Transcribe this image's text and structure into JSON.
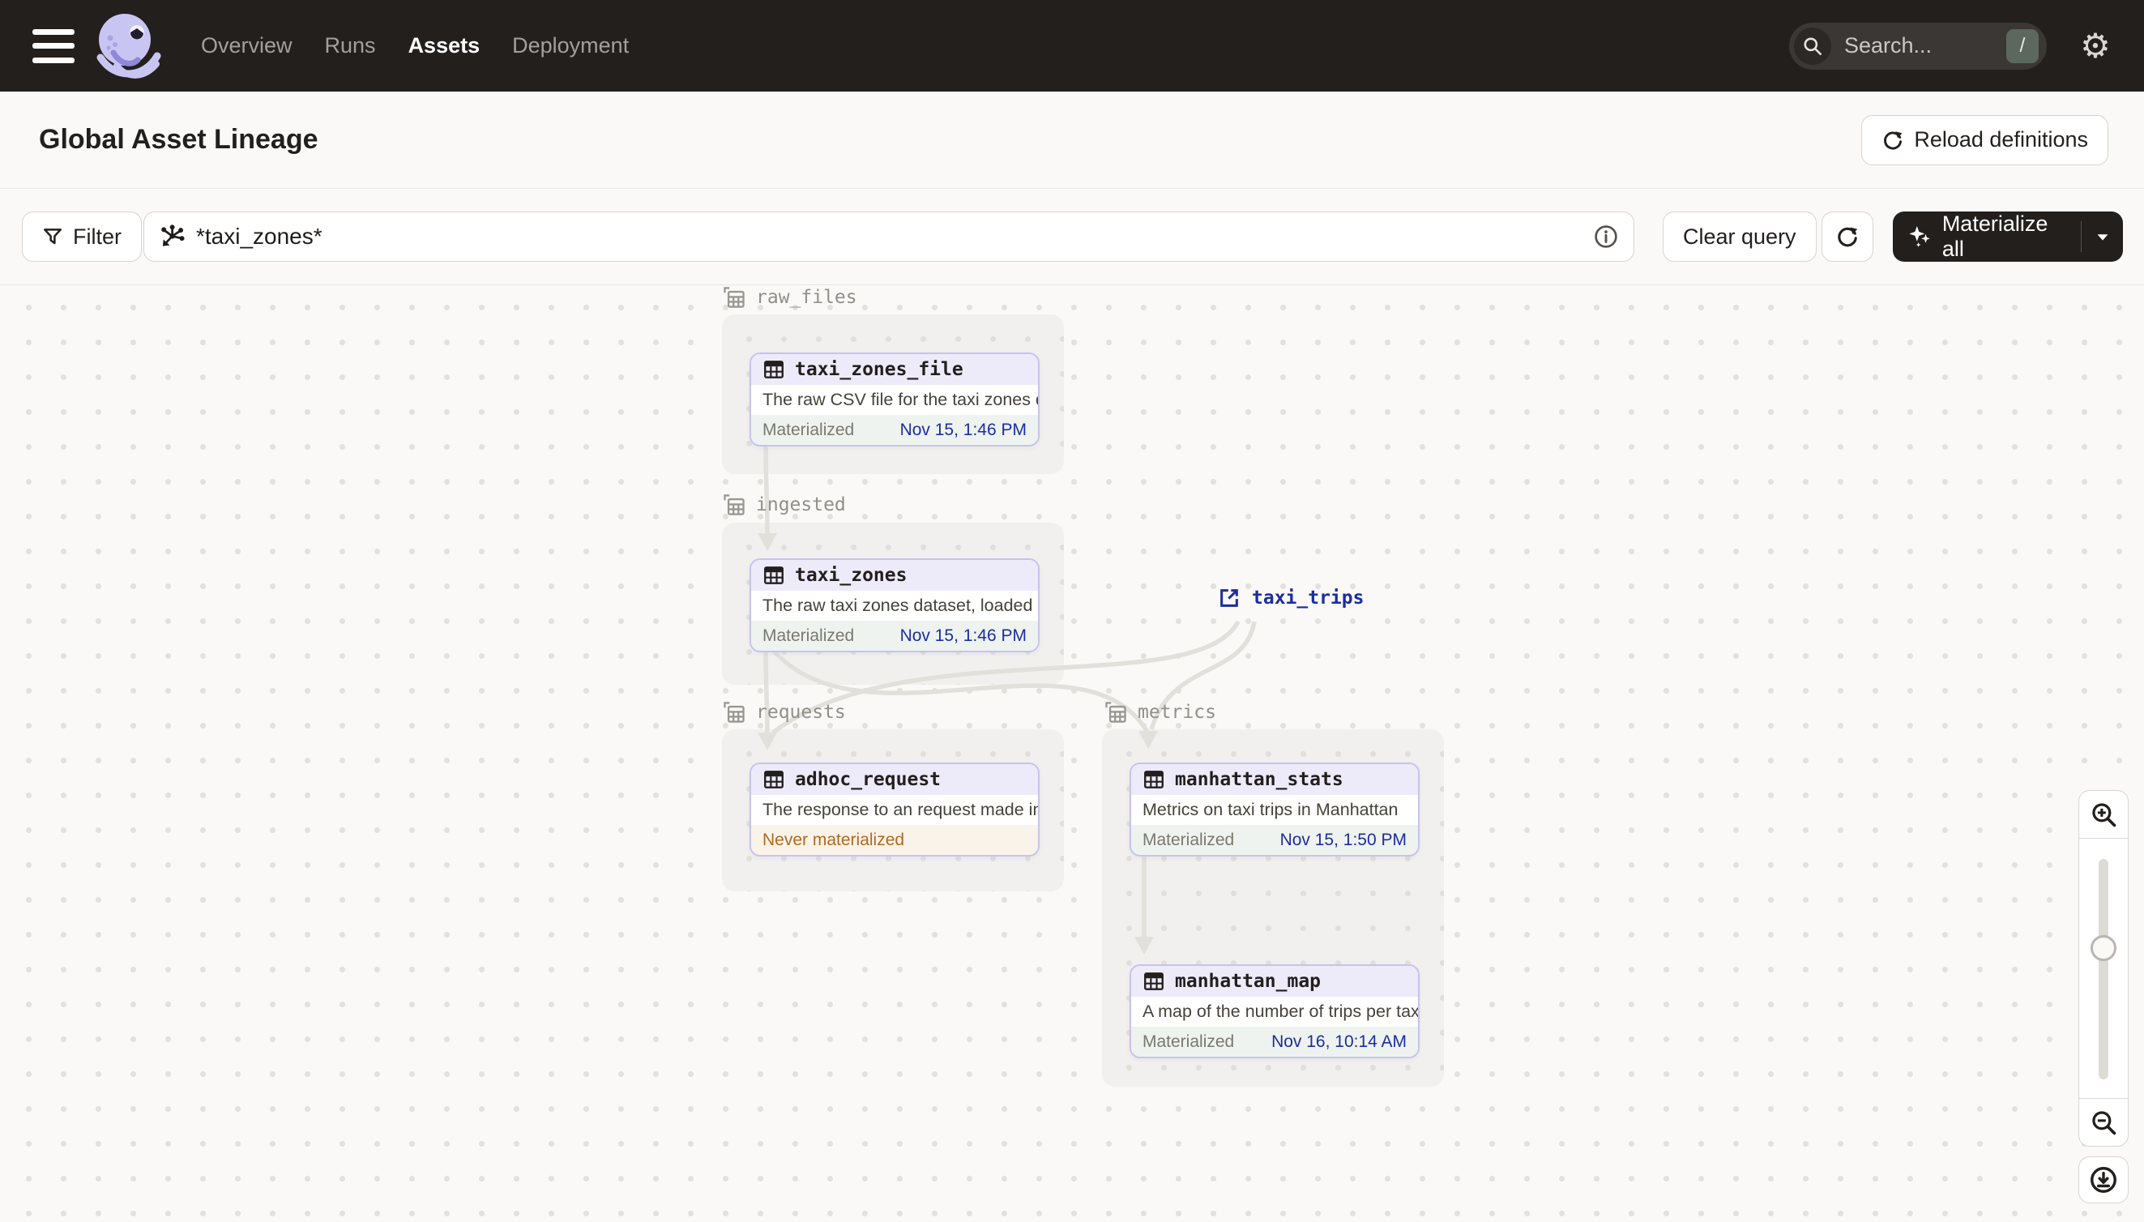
{
  "nav": {
    "items": [
      "Overview",
      "Runs",
      "Assets",
      "Deployment"
    ],
    "active_item": "Assets",
    "search": {
      "placeholder": "Search...",
      "shortcut_key": "/"
    }
  },
  "header": {
    "title": "Global Asset Lineage",
    "reload_button_label": "Reload definitions"
  },
  "toolbar": {
    "filter_label": "Filter",
    "query_input": {
      "value": "*taxi_zones*"
    },
    "clear_query_label": "Clear query",
    "materialize_label": "Materialize all"
  },
  "graph": {
    "groups": [
      {
        "name": "raw_files"
      },
      {
        "name": "ingested"
      },
      {
        "name": "requests"
      },
      {
        "name": "metrics"
      }
    ],
    "nodes": [
      {
        "name": "taxi_zones_file",
        "group": "raw_files",
        "description": "The raw CSV file for the taxi zones dat...",
        "status": "Materialized",
        "timestamp": "Nov 15, 1:46 PM",
        "status_kind": "materialized"
      },
      {
        "name": "taxi_zones",
        "group": "ingested",
        "description": "The raw taxi zones dataset, loaded int...",
        "status": "Materialized",
        "timestamp": "Nov 15, 1:46 PM",
        "status_kind": "materialized"
      },
      {
        "name": "adhoc_request",
        "group": "requests",
        "description": "The response to an request made in th...",
        "status": "Never materialized",
        "timestamp": "",
        "status_kind": "never_materialized"
      },
      {
        "name": "manhattan_stats",
        "group": "metrics",
        "description": "Metrics on taxi trips in Manhattan",
        "status": "Materialized",
        "timestamp": "Nov 15, 1:50 PM",
        "status_kind": "materialized"
      },
      {
        "name": "manhattan_map",
        "group": "metrics",
        "description": "A map of the number of trips per taxi z...",
        "status": "Materialized",
        "timestamp": "Nov 16, 10:14 AM",
        "status_kind": "materialized"
      }
    ],
    "external_assets": [
      {
        "name": "taxi_trips"
      }
    ],
    "edges": [
      {
        "from": "taxi_zones_file",
        "to": "taxi_zones"
      },
      {
        "from": "taxi_zones",
        "to": "adhoc_request"
      },
      {
        "from": "taxi_zones",
        "to": "manhattan_stats"
      },
      {
        "from": "taxi_trips",
        "to": "adhoc_request"
      },
      {
        "from": "taxi_trips",
        "to": "manhattan_stats"
      },
      {
        "from": "manhattan_stats",
        "to": "manhattan_map"
      }
    ]
  },
  "colors": {
    "nav_bg": "#231f1d",
    "canvas_bg": "#faf9f7",
    "group_bg": "#f1f0ee",
    "node_border": "#c7c3ee",
    "node_header_bg": "#edebfa",
    "materialized_bg": "#eef3ef",
    "timestamp_text": "#1c2da3",
    "never_materialized_bg": "#faf3e9",
    "never_materialized_text": "#b2691f",
    "edge": "#e2e0db",
    "link_navy": "#1b2da1"
  }
}
